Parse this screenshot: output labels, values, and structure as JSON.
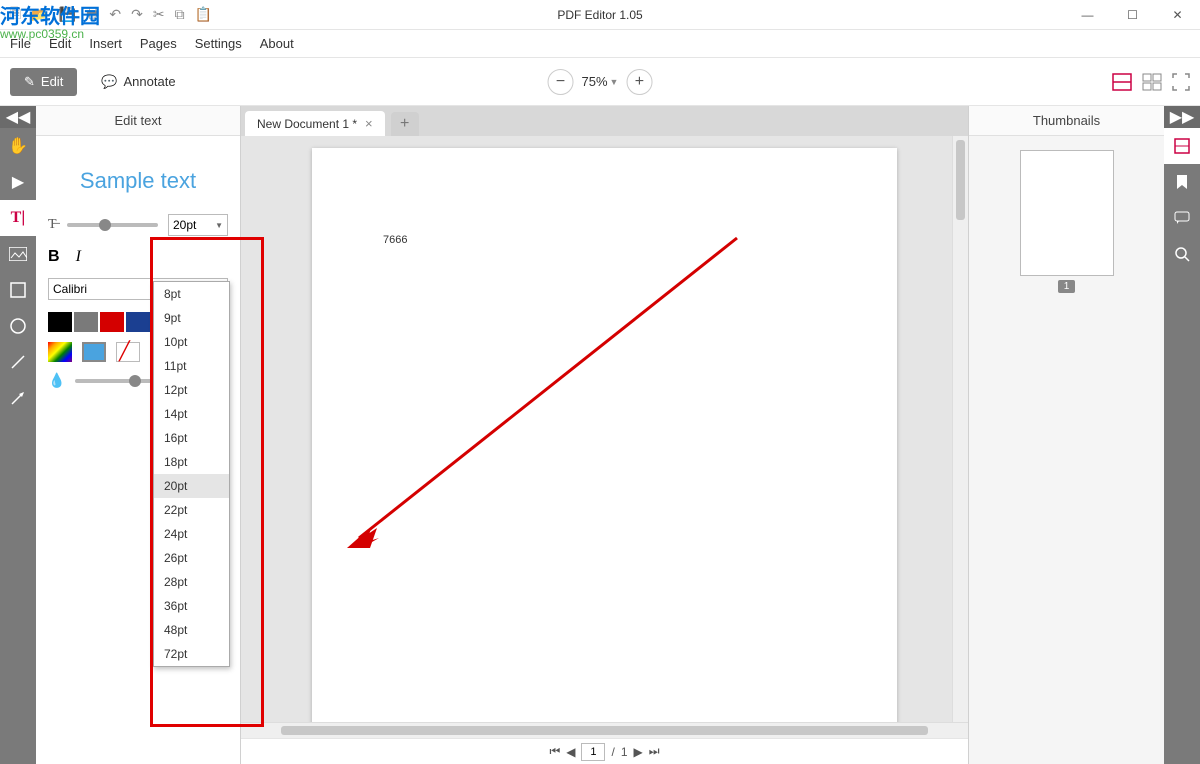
{
  "app": {
    "title": "PDF Editor 1.05"
  },
  "watermark": {
    "line1": "河东软件园",
    "line2": "www.pc0359.cn"
  },
  "menu": {
    "file": "File",
    "edit": "Edit",
    "insert": "Insert",
    "pages": "Pages",
    "settings": "Settings",
    "about": "About"
  },
  "toolbar": {
    "edit": "Edit",
    "annotate": "Annotate",
    "zoom": "75%"
  },
  "left_panel": {
    "title": "Edit text",
    "sample": "Sample text",
    "font_size_value": "20pt",
    "font_name": "Calibri",
    "colors": [
      "#000000",
      "#7a7a7a",
      "#d40000",
      "#1b3f91",
      "#108a2f",
      "#ffffff"
    ],
    "size_options": [
      "8pt",
      "9pt",
      "10pt",
      "11pt",
      "12pt",
      "14pt",
      "16pt",
      "18pt",
      "20pt",
      "22pt",
      "24pt",
      "26pt",
      "28pt",
      "36pt",
      "48pt",
      "72pt"
    ],
    "selected_size": "20pt"
  },
  "tabs": {
    "doc1": "New Document 1 *"
  },
  "page_content": {
    "text": "7666"
  },
  "pager": {
    "current": "1",
    "total": "1",
    "sep": "/"
  },
  "thumbnails": {
    "title": "Thumbnails",
    "page1": "1"
  }
}
